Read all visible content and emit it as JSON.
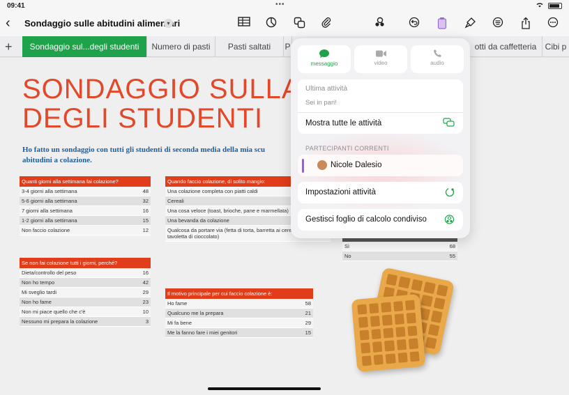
{
  "status": {
    "time": "09:41",
    "dots": "•••"
  },
  "toolbar": {
    "title": "Sondaggio sulle abitudini alimentari",
    "icons": [
      "table-icon",
      "chart-icon",
      "shapes-icon",
      "attachment-icon",
      "collaborate-icon",
      "undo-icon",
      "document-icon",
      "paintbrush-icon",
      "format-icon",
      "share-icon",
      "more-icon"
    ]
  },
  "tabs": [
    {
      "label": "Sondaggio sul...degli studenti",
      "active": true
    },
    {
      "label": "Numero di pasti"
    },
    {
      "label": "Pasti saltati"
    },
    {
      "label": "P"
    },
    {
      "label": "otti da caffetteria"
    },
    {
      "label": "Cibi p"
    }
  ],
  "sheet": {
    "title": "SONDAGGIO SULLA\nDEGLI STUDENTI",
    "intro": "Ho fatto un sondaggio con tutti gli studenti di seconda media della mia scu abitudini a colazione.",
    "tables": [
      {
        "header": "Quanti giorni alla settimana fai colazione?",
        "rows": [
          [
            "3-4 giorni alla settimana",
            "48"
          ],
          [
            "5-6 giorni alla settimana",
            "32"
          ],
          [
            "7 giorni alla settimana",
            "16"
          ],
          [
            "1-2 giorni alla settimana",
            "15"
          ],
          [
            "Non faccio colazione",
            "12"
          ]
        ]
      },
      {
        "header": "Se non fai colazione tutti i giorni, perché?",
        "rows": [
          [
            "Dieta/controllo del peso",
            "16"
          ],
          [
            "Non ho tempo",
            "42"
          ],
          [
            "Mi sveglio tardi",
            "29"
          ],
          [
            "Non ho fame",
            "23"
          ],
          [
            "Non mi piace quello che c'è",
            "10"
          ],
          [
            "Nessuno mi prepara la colazione",
            "3"
          ]
        ]
      },
      {
        "header": "Quando faccio colazione, di solito mangio:",
        "rows": [
          [
            "Una colazione completa con piatti caldi",
            ""
          ],
          [
            "Cereali",
            ""
          ],
          [
            "Una cosa veloce (toast, brioche, pane e marmellata)",
            ""
          ],
          [
            "Una bevanda da colazione",
            "18"
          ],
          [
            "Qualcosa da portare via (fetta di torta, barretta ai cereali, tavoletta di cioccolato)",
            "23"
          ]
        ]
      },
      {
        "header": "Il motivo principale per cui faccio colazione è:",
        "rows": [
          [
            "Ho fame",
            "58"
          ],
          [
            "Qualcuno me la prepara",
            "21"
          ],
          [
            "Mi fa bene",
            "29"
          ],
          [
            "Me la fanno fare i miei genitori",
            "15"
          ]
        ]
      },
      {
        "header": "colazione?",
        "rows": [
          [
            "Sì",
            "68"
          ],
          [
            "No",
            "55"
          ]
        ]
      }
    ]
  },
  "popover": {
    "buttons": [
      {
        "label": "messaggio",
        "icon": "message-icon"
      },
      {
        "label": "video",
        "icon": "video-icon"
      },
      {
        "label": "audio",
        "icon": "phone-icon"
      }
    ],
    "activity_title": "Ultima attività",
    "activity_status": "Sei in pari!",
    "show_all": "Mostra tutte le attività",
    "participants_label": "PARTECIPANTI CORRENTI",
    "participant": "Nicole Dalesio",
    "settings": "Impostazioni attività",
    "manage": "Gestisci foglio di calcolo condiviso"
  }
}
